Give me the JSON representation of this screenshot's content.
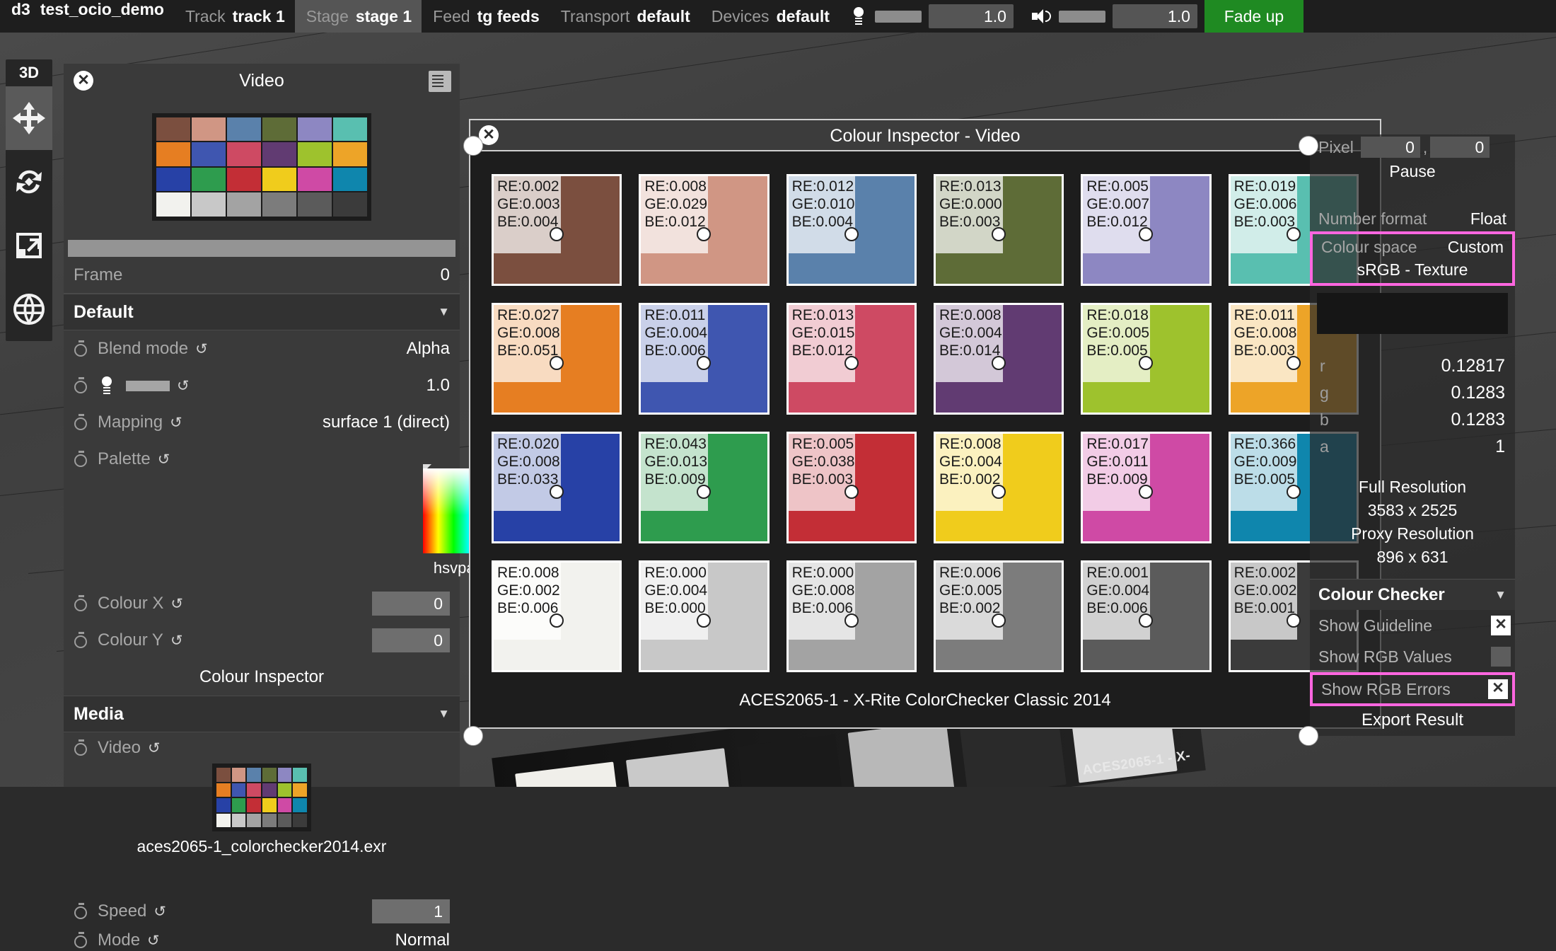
{
  "topbar": {
    "app": "d3",
    "project": "test_ocio_demo",
    "groups": [
      {
        "key": "Track",
        "value": "track 1",
        "active": false
      },
      {
        "key": "Stage",
        "value": "stage 1",
        "active": true
      },
      {
        "key": "Feed",
        "value": "tg feeds",
        "active": false
      },
      {
        "key": "Transport",
        "value": "default",
        "active": false
      },
      {
        "key": "Devices",
        "value": "default",
        "active": false
      }
    ],
    "intensity_value": "1.0",
    "volume_value": "1.0",
    "fade_button": "Fade up",
    "fade_color": "#1f8a22"
  },
  "rail": {
    "title": "3D",
    "tools": [
      {
        "name": "move-tool",
        "selected": true
      },
      {
        "name": "rotate-tool",
        "selected": false
      },
      {
        "name": "scale-tool",
        "selected": false
      },
      {
        "name": "globe-tool",
        "selected": false
      }
    ]
  },
  "video_panel": {
    "title": "Video",
    "frame_label": "Frame",
    "frame_value": "0",
    "default_section": "Default",
    "properties": [
      {
        "label": "Blend mode",
        "value": "Alpha"
      },
      {
        "label": "Mapping",
        "value": "surface 1 (direct)"
      },
      {
        "label": "Palette",
        "value": ""
      }
    ],
    "intensity_value": "1.0",
    "palette_name": "hsvpalette",
    "colour_x_label": "Colour X",
    "colour_x_value": "0",
    "colour_y_label": "Colour Y",
    "colour_y_value": "0",
    "colour_inspector_button": "Colour Inspector",
    "media_section": "Media",
    "video_label": "Video",
    "media_filename": "aces2065-1_colorchecker2014.exr",
    "speed_label": "Speed",
    "speed_value": "1",
    "mode_label": "Mode",
    "mode_value": "Normal"
  },
  "inspector": {
    "title": "Colour Inspector - Video",
    "caption": "ACES2065-1 - X-Rite ColorChecker Classic 2014",
    "patches": [
      {
        "swatch": "#7b4f3f",
        "re": "RE:0.002",
        "ge": "GE:0.003",
        "be": "BE:0.004"
      },
      {
        "swatch": "#d09684",
        "re": "RE:0.008",
        "ge": "GE:0.029",
        "be": "BE:0.012"
      },
      {
        "swatch": "#5a81ab",
        "re": "RE:0.012",
        "ge": "GE:0.010",
        "be": "BE:0.004"
      },
      {
        "swatch": "#5e6c37",
        "re": "RE:0.013",
        "ge": "GE:0.000",
        "be": "BE:0.003"
      },
      {
        "swatch": "#8d87c2",
        "re": "RE:0.005",
        "ge": "GE:0.007",
        "be": "BE:0.012"
      },
      {
        "swatch": "#59bfb0",
        "re": "RE:0.019",
        "ge": "GE:0.006",
        "be": "BE:0.003"
      },
      {
        "swatch": "#e67e22",
        "re": "RE:0.027",
        "ge": "GE:0.008",
        "be": "BE:0.051"
      },
      {
        "swatch": "#3f56b0",
        "re": "RE:0.011",
        "ge": "GE:0.004",
        "be": "BE:0.006"
      },
      {
        "swatch": "#ce4a63",
        "re": "RE:0.013",
        "ge": "GE:0.015",
        "be": "BE:0.012"
      },
      {
        "swatch": "#613b72",
        "re": "RE:0.008",
        "ge": "GE:0.004",
        "be": "BE:0.014"
      },
      {
        "swatch": "#9ec22d",
        "re": "RE:0.018",
        "ge": "GE:0.005",
        "be": "BE:0.005"
      },
      {
        "swatch": "#eda428",
        "re": "RE:0.011",
        "ge": "GE:0.008",
        "be": "BE:0.003"
      },
      {
        "swatch": "#2741a6",
        "re": "RE:0.020",
        "ge": "GE:0.008",
        "be": "BE:0.033"
      },
      {
        "swatch": "#2e9c4e",
        "re": "RE:0.043",
        "ge": "GE:0.013",
        "be": "BE:0.009"
      },
      {
        "swatch": "#c32e36",
        "re": "RE:0.005",
        "ge": "GE:0.038",
        "be": "BE:0.003"
      },
      {
        "swatch": "#f0cc1c",
        "re": "RE:0.008",
        "ge": "GE:0.004",
        "be": "BE:0.002"
      },
      {
        "swatch": "#cf4aa5",
        "re": "RE:0.017",
        "ge": "GE:0.011",
        "be": "BE:0.009"
      },
      {
        "swatch": "#0f86ad",
        "re": "RE:0.366",
        "ge": "GE:0.009",
        "be": "BE:0.005"
      },
      {
        "swatch": "#f2f2ee",
        "re": "RE:0.008",
        "ge": "GE:0.002",
        "be": "BE:0.006"
      },
      {
        "swatch": "#c8c8c8",
        "re": "RE:0.000",
        "ge": "GE:0.004",
        "be": "BE:0.000"
      },
      {
        "swatch": "#a3a3a3",
        "re": "RE:0.000",
        "ge": "GE:0.008",
        "be": "BE:0.006"
      },
      {
        "swatch": "#7c7c7c",
        "re": "RE:0.006",
        "ge": "GE:0.005",
        "be": "BE:0.002"
      },
      {
        "swatch": "#5b5b5b",
        "re": "RE:0.001",
        "ge": "GE:0.004",
        "be": "BE:0.006"
      },
      {
        "swatch": "#3b3b3b",
        "re": "RE:0.002",
        "ge": "GE:0.002",
        "be": "BE:0.001"
      }
    ]
  },
  "sidebar": {
    "pixel_label": "Pixel",
    "pixel_x": "0",
    "pixel_comma": ",",
    "pixel_y": "0",
    "pause_button": "Pause",
    "number_format_label": "Number format",
    "number_format_value": "Float",
    "colour_space_label": "Colour space",
    "colour_space_value": "Custom",
    "colour_space_detail": "sRGB - Texture",
    "highlight_color": "#ff66e0",
    "channels": [
      {
        "key": "r",
        "value": "0.12817"
      },
      {
        "key": "g",
        "value": "0.1283"
      },
      {
        "key": "b",
        "value": "0.1283"
      },
      {
        "key": "a",
        "value": "1"
      }
    ],
    "full_resolution_label": "Full Resolution",
    "full_resolution_value": "3583 x 2525",
    "proxy_resolution_label": "Proxy Resolution",
    "proxy_resolution_value": "896 x 631",
    "colour_checker_section": "Colour Checker",
    "toggles": [
      {
        "label": "Show Guideline",
        "on": true
      },
      {
        "label": "Show RGB Values",
        "on": false
      },
      {
        "label": "Show RGB Errors",
        "on": true
      }
    ],
    "export_button": "Export Result"
  },
  "viewport": {
    "card_label": "ACES2065-1 - X-"
  }
}
